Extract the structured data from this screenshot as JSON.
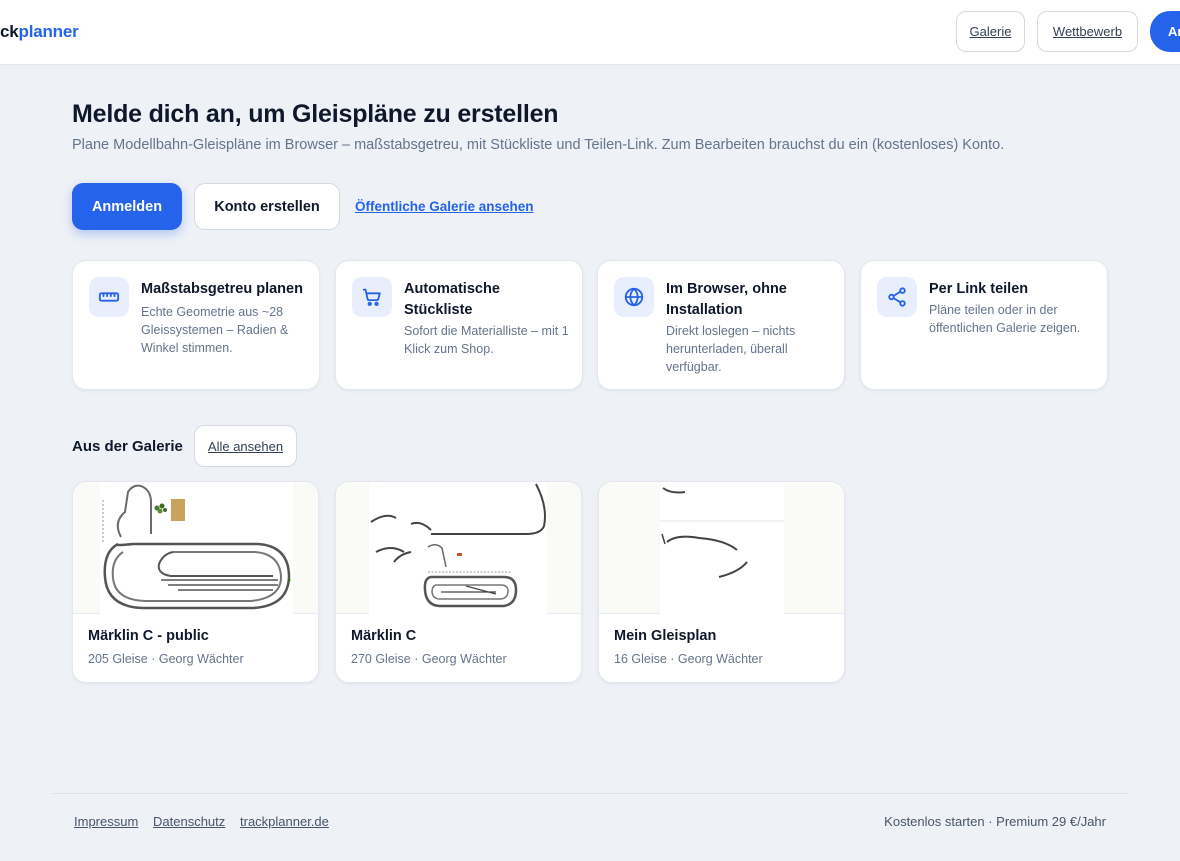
{
  "header": {
    "logo_part1": "ck",
    "logo_part2": "planner",
    "nav_galerie": "Galerie",
    "nav_wettbewerb": "Wettbewerb",
    "nav_login": "Anmelden"
  },
  "hero": {
    "title": "Melde dich an, um Gleispläne zu erstellen",
    "subtitle": "Plane Modellbahn-Gleispläne im Browser – maßstabsgetreu, mit Stückliste und Teilen-Link. Zum Bearbeiten brauchst du ein (kostenloses) Konto.",
    "login_label": "Anmelden",
    "register_label": "Konto erstellen",
    "gallery_link": "Öffentliche Galerie ansehen"
  },
  "features": [
    {
      "icon": "ruler-icon",
      "title": "Maßstabsgetreu planen",
      "desc": "Echte Geometrie aus ~28 Gleissystemen – Radien & Winkel stimmen."
    },
    {
      "icon": "cart-icon",
      "title": "Automatische Stückliste",
      "desc": "Sofort die Materialliste – mit 1 Klick zum Shop."
    },
    {
      "icon": "globe-icon",
      "title": "Im Browser, ohne Installation",
      "desc": "Direkt loslegen – nichts herunterladen, überall verfügbar."
    },
    {
      "icon": "share-icon",
      "title": "Per Link teilen",
      "desc": "Pläne teilen oder in der öffentlichen Galerie zeigen."
    }
  ],
  "gallery": {
    "title": "Aus der Galerie",
    "all_label": "Alle ansehen",
    "items": [
      {
        "name": "Märklin C - public",
        "meta": "205 Gleise · Georg Wächter"
      },
      {
        "name": "Märklin C",
        "meta": "270 Gleise · Georg Wächter"
      },
      {
        "name": "Mein Gleisplan",
        "meta": "16 Gleise · Georg Wächter"
      }
    ]
  },
  "footer": {
    "impressum": "Impressum",
    "datenschutz": "Datenschutz",
    "site": "trackplanner.de",
    "pricing": "Kostenlos starten · Premium 29 €/Jahr"
  },
  "colors": {
    "accent": "#2563eb",
    "background": "#eef1f6",
    "text": "#0f172a",
    "muted": "#64748b"
  }
}
